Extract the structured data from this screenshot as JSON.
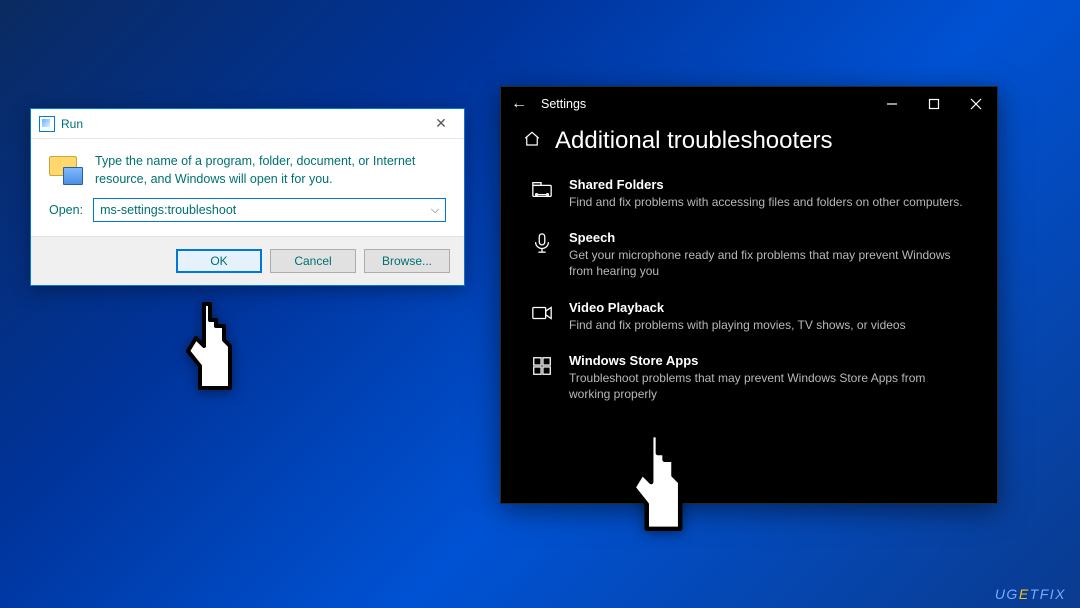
{
  "run": {
    "title": "Run",
    "desc": "Type the name of a program, folder, document, or Internet resource, and Windows will open it for you.",
    "open_label": "Open:",
    "open_value": "ms-settings:troubleshoot",
    "ok_label": "OK",
    "cancel_label": "Cancel",
    "browse_label": "Browse..."
  },
  "settings": {
    "window_title": "Settings",
    "page_title": "Additional troubleshooters",
    "items": [
      {
        "title": "Shared Folders",
        "desc": "Find and fix problems with accessing files and folders on other computers."
      },
      {
        "title": "Speech",
        "desc": "Get your microphone ready and fix problems that may prevent Windows from hearing you"
      },
      {
        "title": "Video Playback",
        "desc": "Find and fix problems with playing movies, TV shows, or videos"
      },
      {
        "title": "Windows Store Apps",
        "desc": "Troubleshoot problems that may prevent Windows Store Apps from working properly"
      }
    ]
  },
  "watermark": {
    "pre": "UG",
    "accent": "E",
    "post": "TFIX"
  }
}
